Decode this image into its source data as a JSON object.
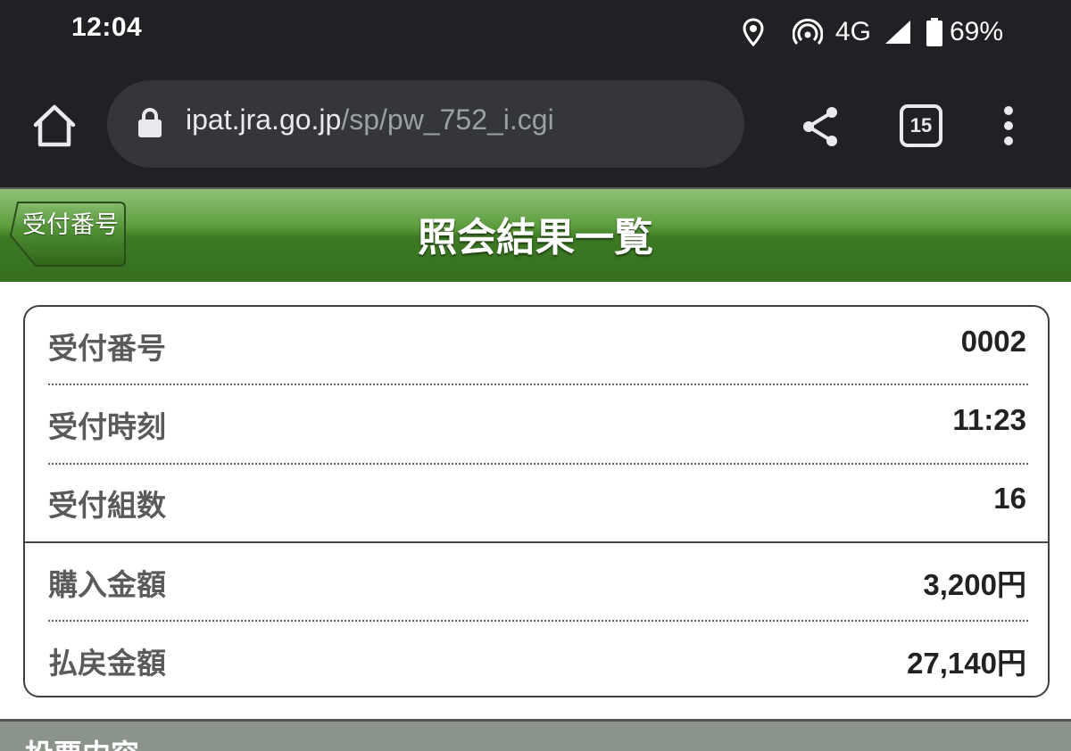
{
  "status_bar": {
    "time": "12:04",
    "network": "4G",
    "battery": "69%",
    "icons": [
      "location-icon",
      "hotspot-icon",
      "signal-icon",
      "battery-icon"
    ]
  },
  "browser": {
    "url_host": "ipat.jra.go.jp",
    "url_path": "/sp/pw_752_i.cgi",
    "tab_count": "15"
  },
  "header": {
    "back_label": "受付番号",
    "title": "照会結果一覧"
  },
  "summary": {
    "rows": [
      {
        "label": "受付番号",
        "value": "0002"
      },
      {
        "label": "受付時刻",
        "value": "11:23"
      },
      {
        "label": "受付組数",
        "value": "16"
      },
      {
        "label": "購入金額",
        "value": "3,200円"
      },
      {
        "label": "払戻金額",
        "value": "27,140円"
      }
    ]
  },
  "section": {
    "title": "投票内容"
  },
  "colors": {
    "status_bg": "#202124",
    "omnibox_bg": "#35363a",
    "header_green": "#3e7a25",
    "section_grey": "#8a948a"
  }
}
